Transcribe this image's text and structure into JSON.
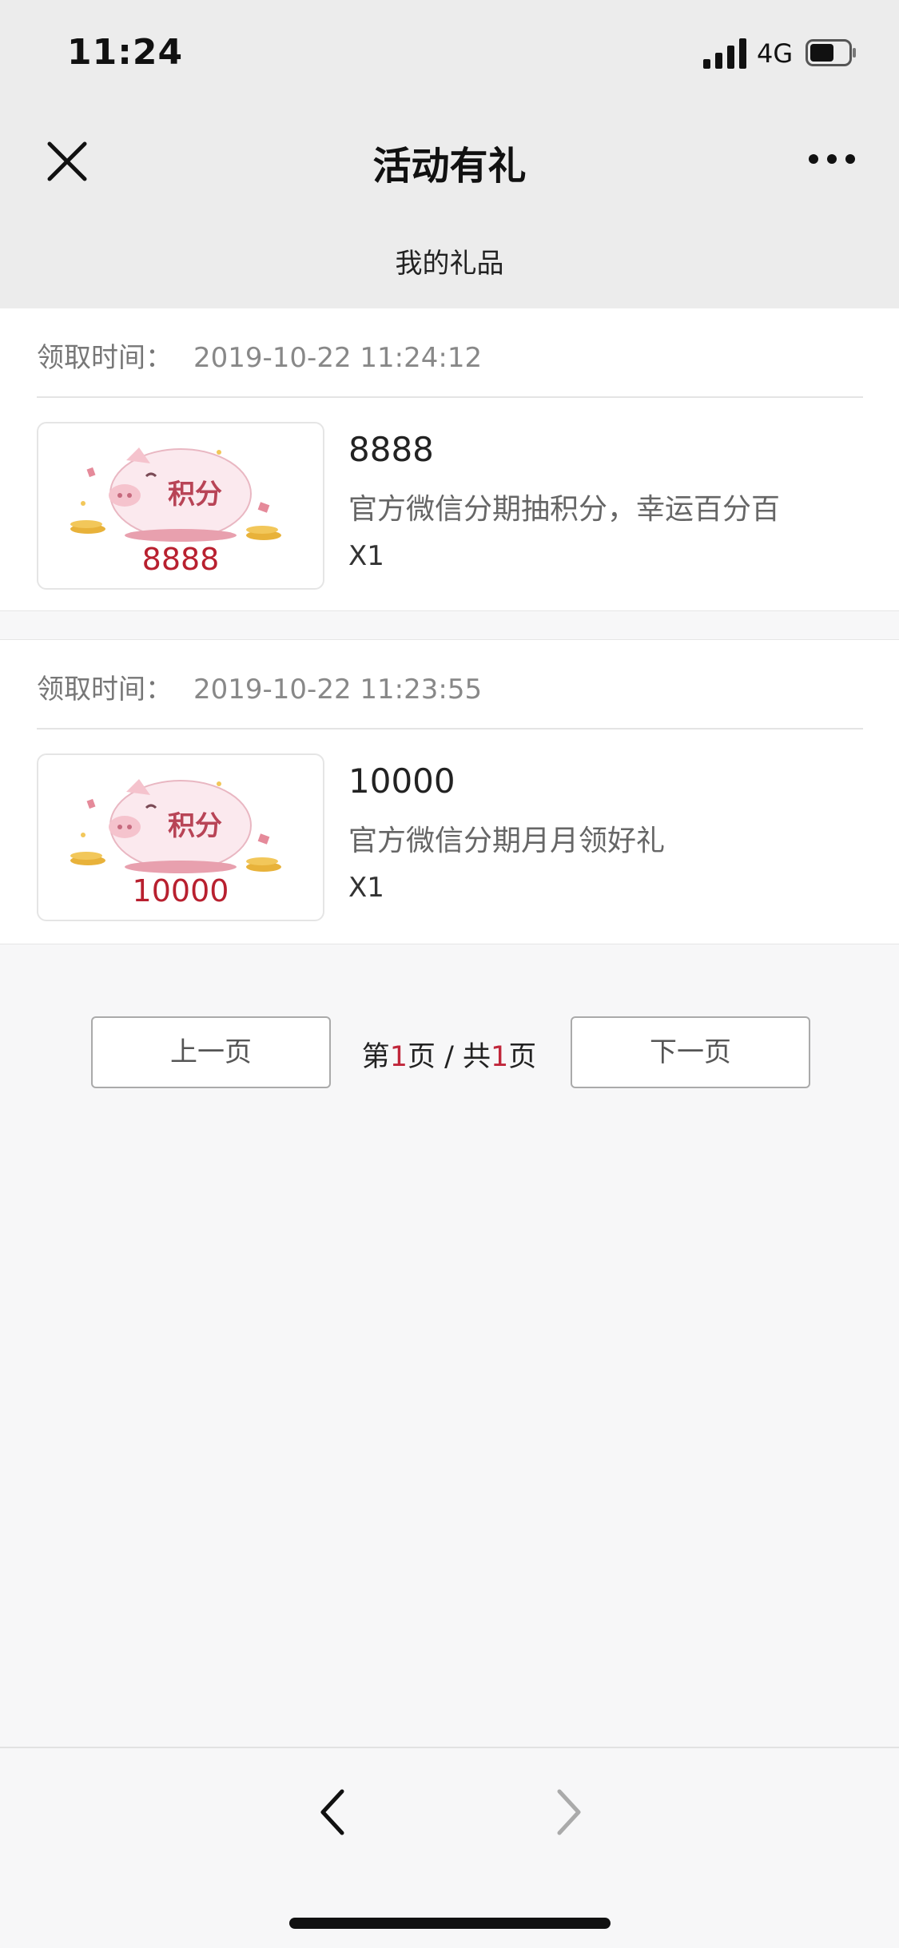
{
  "status": {
    "time": "11:24",
    "network": "4G"
  },
  "nav": {
    "title": "活动有礼"
  },
  "subheader": {
    "title": "我的礼品"
  },
  "gifts": [
    {
      "time_label": "领取时间：",
      "time": "2019-10-22 11:24:12",
      "image_label": "积分",
      "image_amount": "8888",
      "title": "8888",
      "description": "官方微信分期抽积分，幸运百分百",
      "quantity": "X1"
    },
    {
      "time_label": "领取时间：",
      "time": "2019-10-22 11:23:55",
      "image_label": "积分",
      "image_amount": "10000",
      "title": "10000",
      "description": "官方微信分期月月领好礼",
      "quantity": "X1"
    }
  ],
  "pager": {
    "prev_label": "上一页",
    "next_label": "下一页",
    "page_prefix": "第",
    "current_page": "1",
    "page_mid": "页 / 共",
    "total_pages": "1",
    "page_suffix": "页"
  },
  "colors": {
    "accent": "#c0263a",
    "header_bg": "#ececec"
  },
  "icons": [
    "close-icon",
    "more-icon",
    "signal-icon",
    "battery-icon",
    "back-arrow-icon",
    "forward-arrow-icon"
  ]
}
